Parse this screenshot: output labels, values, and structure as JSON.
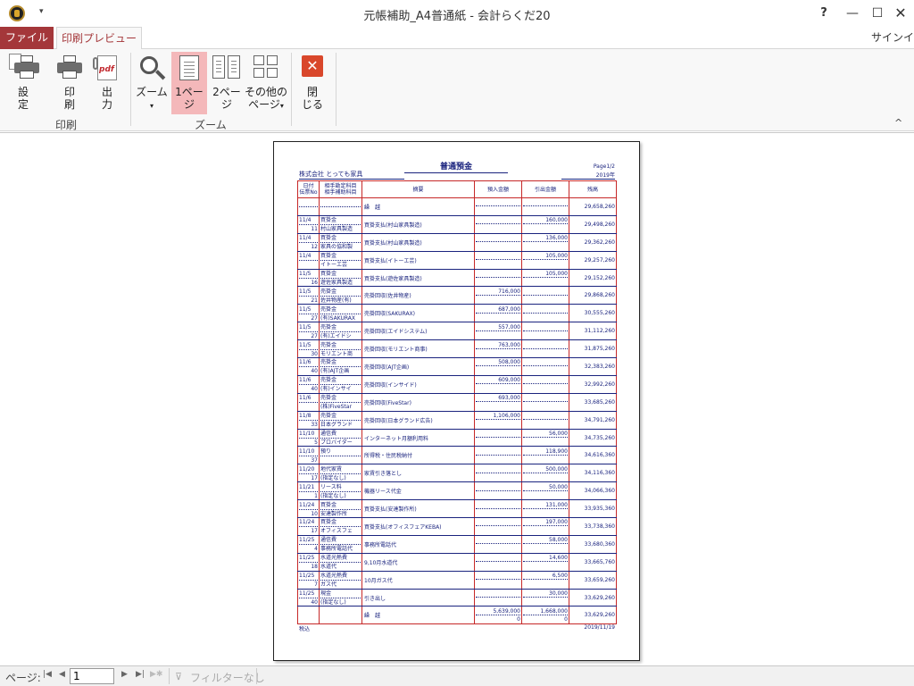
{
  "window": {
    "title": "元帳補助_A4普通紙 - 会計らくだ20",
    "help": "?",
    "minimize": "—",
    "maximize": "☐",
    "close": "✕",
    "qat": "▾"
  },
  "tabs": {
    "file": "ファイル",
    "preview": "印刷プレビュー",
    "signin": "サインイン"
  },
  "ribbon": {
    "setup": "設\n定",
    "print": "印\n刷",
    "output": "出\n力",
    "zoom": "ズーム",
    "zoom_arrow": "▾",
    "one_page": "1ペー\nジ",
    "two_page": "2ペー\nジ",
    "other_pages": "その他の\nページ",
    "other_arrow": "▾",
    "close": "閉\nじる",
    "group_print": "印刷",
    "group_zoom": "ズーム",
    "collapse": "^"
  },
  "report": {
    "title": "普通預金",
    "company": "株式会社 とっても家具",
    "page": "Page1/2",
    "year": "2019年",
    "footer_left": "税込",
    "footer_right": "2019/11/19",
    "headers": {
      "date_top": "日付",
      "date_bot": "伝票No",
      "acct_top": "相手勘定科目",
      "acct_bot": "相手補助科目",
      "desc": "摘要",
      "deposit": "預入金額",
      "withdrawal": "引出金額",
      "balance": "残高"
    },
    "rows": [
      {
        "d": "",
        "n": "",
        "a": "",
        "s": "",
        "desc": "繰　越",
        "dep": "",
        "wd": "",
        "bal": "29,658,260"
      },
      {
        "d": "11/4",
        "n": "11",
        "a": "買掛金",
        "s": "村山家具製造",
        "desc": "買掛支払(村山家具製造)",
        "dep": "",
        "wd": "160,000",
        "bal": "29,498,260"
      },
      {
        "d": "11/4",
        "n": "12",
        "a": "買掛金",
        "s": "家具の協和製",
        "desc": "買掛支払(村山家具製造)",
        "dep": "",
        "wd": "136,000",
        "bal": "29,362,260"
      },
      {
        "d": "11/4",
        "n": "",
        "a": "買掛金",
        "s": "イトーエ芸",
        "desc": "買掛支払(イトーエ芸)",
        "dep": "",
        "wd": "105,000",
        "bal": "29,257,260"
      },
      {
        "d": "11/5",
        "n": "16",
        "a": "買掛金",
        "s": "遊佐家具製造",
        "desc": "買掛支払(遊佐家具製造)",
        "dep": "",
        "wd": "105,000",
        "bal": "29,152,260"
      },
      {
        "d": "11/5",
        "n": "21",
        "a": "売掛金",
        "s": "佐井物産(有)",
        "desc": "売掛回収(佐井物産)",
        "dep": "716,000",
        "wd": "",
        "bal": "29,868,260"
      },
      {
        "d": "11/5",
        "n": "27",
        "a": "売掛金",
        "s": "(有)SAKURAX",
        "desc": "売掛回収(SAKURAX)",
        "dep": "687,000",
        "wd": "",
        "bal": "30,555,260"
      },
      {
        "d": "11/5",
        "n": "27",
        "a": "売掛金",
        "s": "(有)エイドシ",
        "desc": "売掛回収(エイドシステム)",
        "dep": "557,000",
        "wd": "",
        "bal": "31,112,260"
      },
      {
        "d": "11/5",
        "n": "30",
        "a": "売掛金",
        "s": "モリエント商",
        "desc": "売掛回収(モリエント商事)",
        "dep": "763,000",
        "wd": "",
        "bal": "31,875,260"
      },
      {
        "d": "11/6",
        "n": "40",
        "a": "売掛金",
        "s": "(有)AJT企画",
        "desc": "売掛回収(AJT企画)",
        "dep": "508,000",
        "wd": "",
        "bal": "32,383,260"
      },
      {
        "d": "11/6",
        "n": "40",
        "a": "売掛金",
        "s": "(有)インサイ",
        "desc": "売掛回収(インサイド)",
        "dep": "609,000",
        "wd": "",
        "bal": "32,992,260"
      },
      {
        "d": "11/6",
        "n": "",
        "a": "売掛金",
        "s": "(株)FiveStar",
        "desc": "売掛回収(FiveStar)",
        "dep": "693,000",
        "wd": "",
        "bal": "33,685,260"
      },
      {
        "d": "11/8",
        "n": "33",
        "a": "売掛金",
        "s": "日本グランド",
        "desc": "売掛回収(日本グランド広告)",
        "dep": "1,106,000",
        "wd": "",
        "bal": "34,791,260"
      },
      {
        "d": "11/10",
        "n": "5",
        "a": "通信費",
        "s": "プロバイダー",
        "desc": "インターネット月額利用料",
        "dep": "",
        "wd": "56,000",
        "bal": "34,735,260"
      },
      {
        "d": "11/10",
        "n": "37",
        "a": "預り",
        "s": "",
        "desc": "所得税・住民税納付",
        "dep": "",
        "wd": "118,900",
        "bal": "34,616,360"
      },
      {
        "d": "11/20",
        "n": "17",
        "a": "地代家賃",
        "s": "(指定なし)",
        "desc": "家賃引き落とし",
        "dep": "",
        "wd": "500,000",
        "bal": "34,116,360"
      },
      {
        "d": "11/21",
        "n": "1",
        "a": "リース料",
        "s": "(指定なし)",
        "desc": "機器リース代金",
        "dep": "",
        "wd": "50,000",
        "bal": "34,066,360"
      },
      {
        "d": "11/24",
        "n": "10",
        "a": "買掛金",
        "s": "安達製作所",
        "desc": "買掛支払(安達製作所)",
        "dep": "",
        "wd": "131,000",
        "bal": "33,935,360"
      },
      {
        "d": "11/24",
        "n": "17",
        "a": "買掛金",
        "s": "オフィスフェ",
        "desc": "買掛支払(オフィスフェアKEBA)",
        "dep": "",
        "wd": "197,000",
        "bal": "33,738,360"
      },
      {
        "d": "11/25",
        "n": "4",
        "a": "通信費",
        "s": "事務所電話代",
        "desc": "事務所電話代",
        "dep": "",
        "wd": "58,000",
        "bal": "33,680,360"
      },
      {
        "d": "11/25",
        "n": "18",
        "a": "水道光熱費",
        "s": "水道代",
        "desc": "9,10月水道代",
        "dep": "",
        "wd": "14,600",
        "bal": "33,665,760"
      },
      {
        "d": "11/25",
        "n": "7",
        "a": "水道光熱費",
        "s": "ガス代",
        "desc": "10月ガス代",
        "dep": "",
        "wd": "6,500",
        "bal": "33,659,260"
      },
      {
        "d": "11/25",
        "n": "40",
        "a": "現金",
        "s": "(指定なし)",
        "desc": "引き出し",
        "dep": "",
        "wd": "30,000",
        "bal": "33,629,260"
      }
    ],
    "carry": {
      "desc": "繰　越",
      "dep_top": "5,639,000",
      "dep_bot": "0",
      "wd_top": "1,668,000",
      "wd_bot": "0",
      "bal": "33,629,260"
    }
  },
  "statusbar": {
    "label": "ページ:",
    "first": "|◀",
    "prev": "◀",
    "next": "▶",
    "last": "▶|",
    "new": "▶✱",
    "page_value": "1",
    "filter_icon": "⊽",
    "filter": "フィルターなし"
  }
}
